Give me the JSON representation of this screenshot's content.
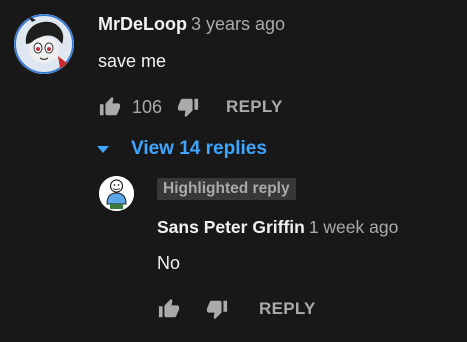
{
  "comment": {
    "author": "MrDeLoop",
    "time": "3 years ago",
    "text": "save me",
    "like_count": "106",
    "reply_label": "REPLY",
    "avatar_icon": "pony-avatar-icon"
  },
  "replies_toggle": {
    "label": "View 14 replies",
    "color": "#3ea6ff"
  },
  "reply": {
    "badge": "Highlighted reply",
    "author": "Sans Peter Griffin",
    "time": "1 week ago",
    "text": "No",
    "reply_label": "REPLY",
    "avatar_icon": "peter-sans-avatar-icon"
  },
  "colors": {
    "background": "#181818",
    "text_primary": "#f1f1f1",
    "text_secondary": "#aaaaaa",
    "accent": "#3ea6ff"
  }
}
